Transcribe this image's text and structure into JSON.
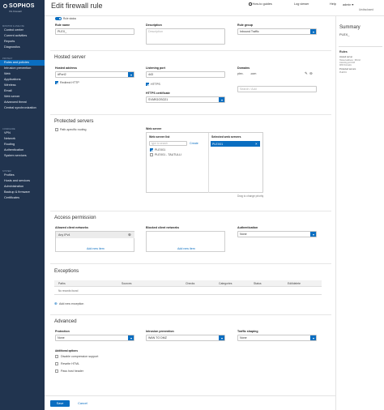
{
  "brand": {
    "name": "SOPHOS",
    "product": "XG Firewall"
  },
  "sidebar": {
    "sections": [
      {
        "title": "MONITOR & ANALYZE",
        "items": [
          "Control center",
          "Current activities",
          "Reports",
          "Diagnostics"
        ]
      },
      {
        "title": "PROTECT",
        "items": [
          "Rules and policies",
          "Intrusion prevention",
          "Web",
          "Applications",
          "Wireless",
          "Email",
          "Web server",
          "Advanced threat",
          "Central synchronization"
        ]
      },
      {
        "title": "CONFIGURE",
        "items": [
          "VPN",
          "Network",
          "Routing",
          "Authentication",
          "System services"
        ]
      },
      {
        "title": "SYSTEM",
        "items": [
          "Profiles",
          "Hosts and services",
          "Administration",
          "Backup & firmware",
          "Certificates"
        ]
      }
    ]
  },
  "header": {
    "title": "Edit firewall rule",
    "how_to": "How-to guides",
    "log_viewer": "Log viewer",
    "help": "Help",
    "user": "admin",
    "user_sub": "Undisclosed"
  },
  "rule": {
    "status_label": "Rule status",
    "name_label": "Rule name",
    "name_value": "PLEX_",
    "description_label": "Description",
    "description_placeholder": "Description",
    "group_label": "Rule group",
    "group_value": "Inbound Traffic"
  },
  "hosted_server": {
    "title": "Hosted server",
    "address_label": "Hosted address",
    "address_value": "#Port2",
    "redirect_label": "Redirect HTTP",
    "port_label": "Listening port",
    "port_value": "443",
    "https_label": "HTTPS",
    "cert_label": "HTTPS certificate",
    "cert_value": "SYARGOSO21",
    "domains_label": "Domains",
    "domains_value": "plex.",
    "domains_value2": ".com",
    "search_placeholder": "Search / Add"
  },
  "protected_servers": {
    "title": "Protected servers",
    "path_routing_label": "Path-specific routing",
    "web_server_label": "Web server",
    "list_title": "Web server list",
    "list_search": "type to search",
    "create": "Create",
    "items": [
      "PLEX01",
      "PLEX01 - TAUTULLI"
    ],
    "selected_title": "Selected web servers",
    "selected": [
      "PLEX01"
    ],
    "hint": "Drag to change priority"
  },
  "access": {
    "title": "Access permission",
    "allowed_label": "Allowed client networks",
    "allowed_value": "Any IPv4",
    "add_new": "Add new item",
    "blocked_label": "Blocked client networks",
    "blocked_add": "Add new item",
    "auth_label": "Authentication",
    "auth_value": "None"
  },
  "exceptions": {
    "title": "Exceptions",
    "columns": [
      "Paths",
      "Sources",
      "Checks",
      "Categories",
      "Status",
      "Edit/delete"
    ],
    "empty": "No records found",
    "add": "Add new exception"
  },
  "advanced": {
    "title": "Advanced",
    "protection_label": "Protection",
    "protection_value": "None",
    "ips_label": "Intrusion prevention",
    "ips_value": "WAN TO DMZ",
    "shaping_label": "Traffic shaping",
    "shaping_value": "None",
    "options_label": "Additional options",
    "options": [
      "Disable compression support",
      "Rewrite HTML",
      "Pass host header"
    ]
  },
  "footer": {
    "save": "Save",
    "cancel": "Cancel"
  },
  "summary": {
    "title": "Summary",
    "name": "PLEX_",
    "rules_h": "Rules",
    "hs_h": "Hosted server",
    "hs_v1": "Hosted address : #Port2",
    "hs_v2": "Listening port 443",
    "hs_v3": "With Domains",
    "ps_h": "Protected servers",
    "ps_v1": "PLEX01"
  },
  "colors": {
    "sidebar": "#21344f",
    "accent": "#0a6ec1"
  }
}
